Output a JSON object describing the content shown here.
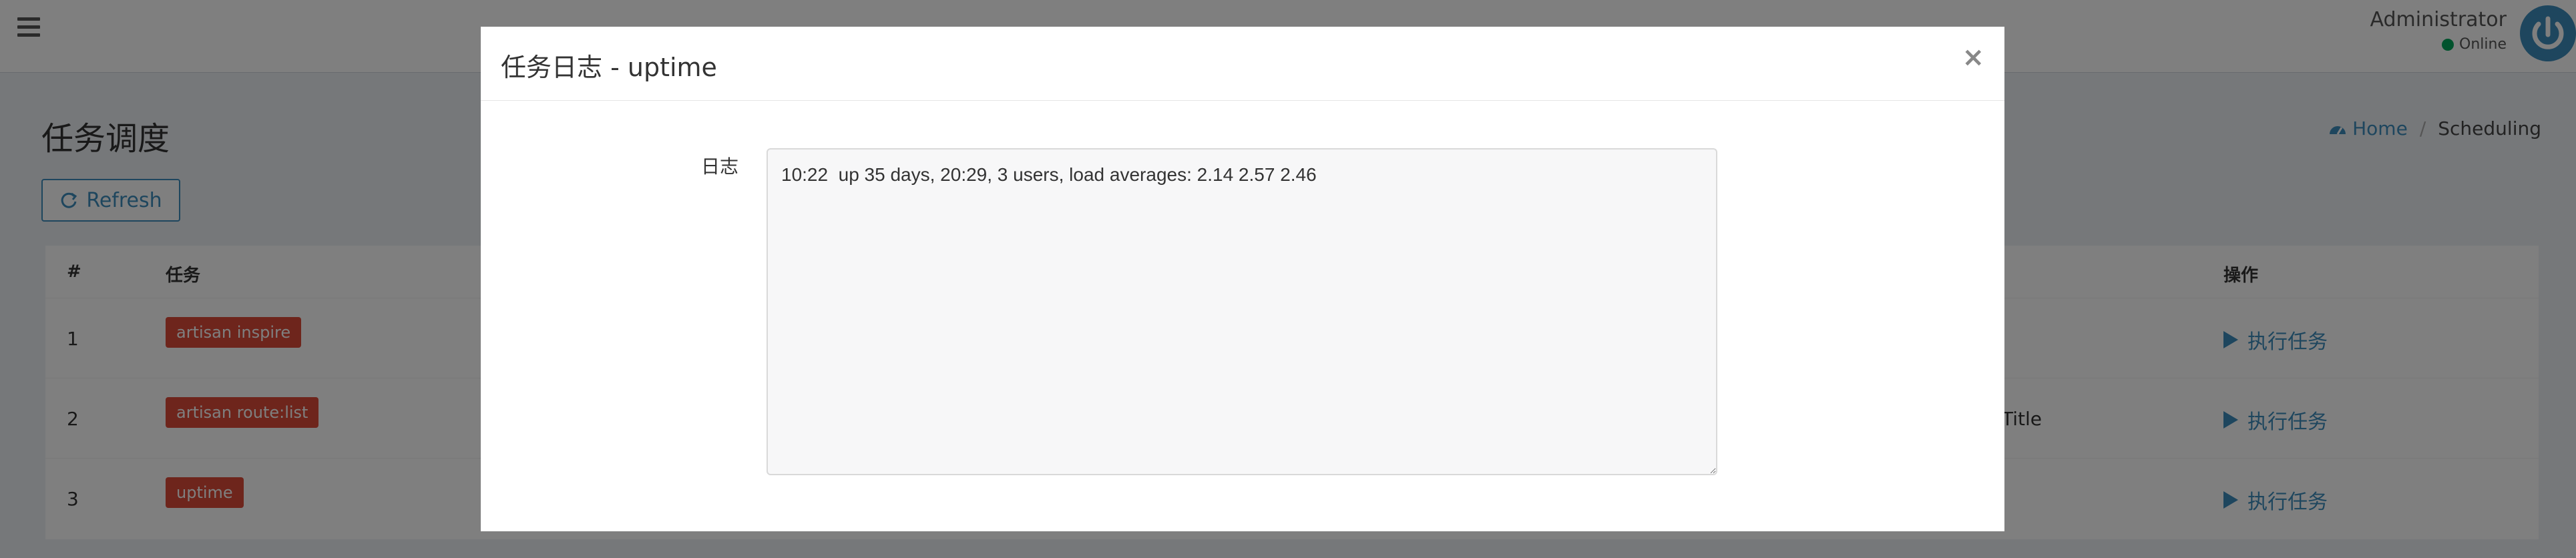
{
  "header": {
    "user_name": "Administrator",
    "user_status": "Online"
  },
  "page": {
    "title": "任务调度",
    "refresh_label": "Refresh"
  },
  "breadcrumb": {
    "home": "Home",
    "current": "Scheduling"
  },
  "table": {
    "columns": {
      "num": "#",
      "task": "任务",
      "action": "操作"
    },
    "rows": [
      {
        "num": "1",
        "task": "artisan inspire",
        "extra": "",
        "action": "执行任务"
      },
      {
        "num": "2",
        "task": "artisan route:list",
        "extra": "Title",
        "action": "执行任务"
      },
      {
        "num": "3",
        "task": "uptime",
        "extra": "",
        "action": "执行任务"
      }
    ]
  },
  "modal": {
    "title": "任务日志 - uptime",
    "close": "×",
    "log_label": "日志",
    "log_value": "10:22  up 35 days, 20:29, 3 users, load averages: 2.14 2.57 2.46"
  },
  "colors": {
    "primary": "#3c8dbc",
    "badge": "#dd4b39",
    "online": "#00a65a"
  },
  "icons": [
    "menu-icon",
    "power-icon",
    "dashboard-icon",
    "refresh-icon",
    "play-icon",
    "close-icon"
  ]
}
